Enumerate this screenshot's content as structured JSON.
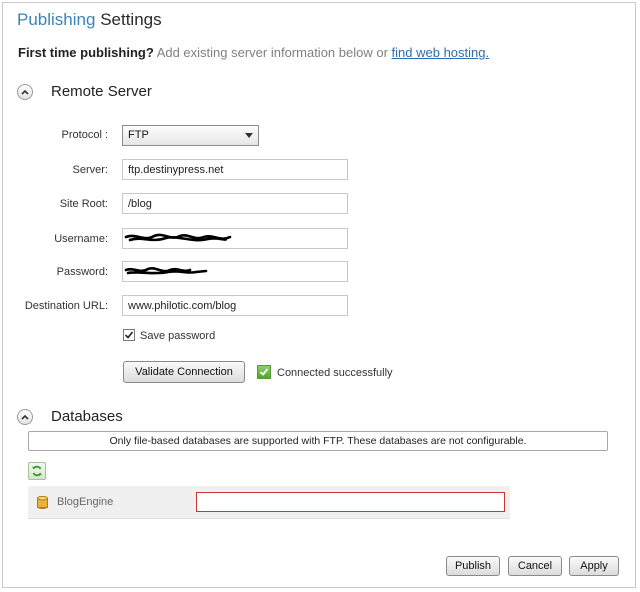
{
  "header": {
    "title_part1": "Publishing",
    "title_part2": "Settings"
  },
  "intro": {
    "lead": "First time publishing?",
    "description": "Add existing server information below or",
    "link": "find web hosting."
  },
  "remote_server": {
    "heading": "Remote Server",
    "protocol_label": "Protocol :",
    "protocol_value": "FTP",
    "server_label": "Server:",
    "server_value": "ftp.destinypress.net",
    "site_root_label": "Site Root:",
    "site_root_value": "/blog",
    "username_label": "Username:",
    "password_label": "Password:",
    "destination_label": "Destination URL:",
    "destination_value": "www.philotic.com/blog",
    "save_password_label": "Save password",
    "save_password_checked": true,
    "validate_label": "Validate Connection",
    "status_text": "Connected successfully"
  },
  "databases": {
    "heading": "Databases",
    "notice": "Only file-based databases are supported with FTP. These databases are not configurable.",
    "items": [
      {
        "name": "BlogEngine",
        "value": ""
      }
    ]
  },
  "footer": {
    "publish_label": "Publish",
    "cancel_label": "Cancel",
    "apply_label": "Apply"
  },
  "colors": {
    "accent": "#3a84b8",
    "link": "#2c6fb0",
    "error_border": "#c8363a",
    "success": "#4ea52b"
  },
  "icons": {
    "collapse": "chevron-up-icon",
    "status": "checkmark-icon",
    "refresh": "refresh-icon",
    "database": "database-icon"
  }
}
